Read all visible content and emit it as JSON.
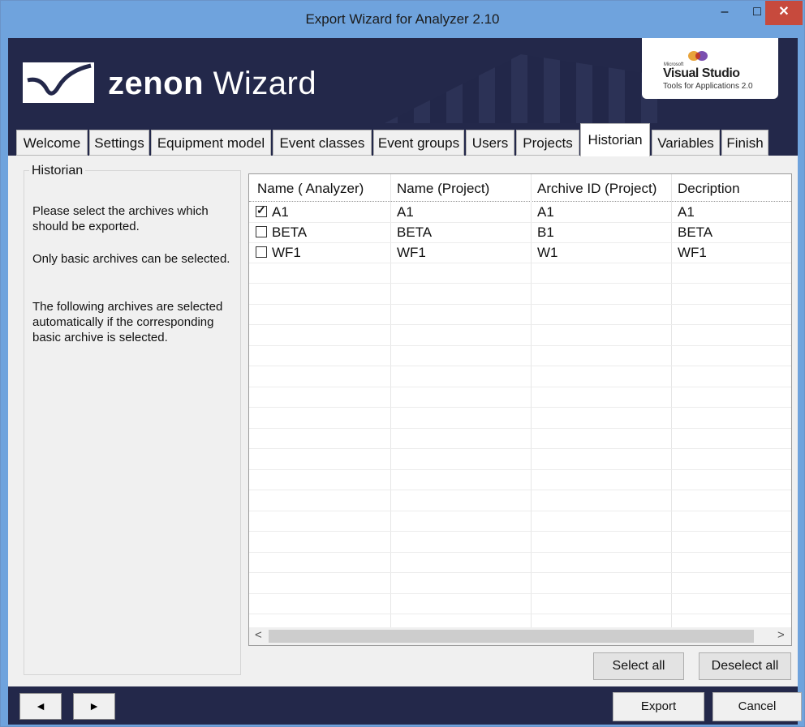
{
  "window": {
    "title": "Export Wizard for Analyzer 2.10",
    "minimize_glyph": "–",
    "maximize_glyph": "□",
    "close_glyph": "✕"
  },
  "banner": {
    "brand_bold": "zenon",
    "brand_rest": " Wizard",
    "vs_small": "Microsoft",
    "vs_name": "Visual Studio",
    "vs_sub": "Tools for Applications 2.0"
  },
  "tabs": [
    {
      "label": "Welcome"
    },
    {
      "label": "Settings"
    },
    {
      "label": "Equipment model"
    },
    {
      "label": "Event classes"
    },
    {
      "label": "Event groups"
    },
    {
      "label": "Users"
    },
    {
      "label": "Projects"
    },
    {
      "label": "Historian"
    },
    {
      "label": "Variables"
    },
    {
      "label": "Finish"
    }
  ],
  "active_tab": "Historian",
  "group": {
    "label": "Historian",
    "paragraphs": [
      "Please select the archives which should be exported.",
      "Only basic archives can be selected.",
      "The following archives are selected automatically if the corresponding basic archive is selected."
    ]
  },
  "grid": {
    "columns": [
      "Name ( Analyzer)",
      "Name (Project)",
      "Archive ID (Project)",
      "Decription"
    ],
    "rows": [
      {
        "checked": true,
        "cells": [
          "A1",
          "A1",
          "A1",
          "A1"
        ]
      },
      {
        "checked": false,
        "cells": [
          "BETA",
          "BETA",
          "B1",
          "BETA"
        ]
      },
      {
        "checked": false,
        "cells": [
          "WF1",
          "WF1",
          "W1",
          "WF1"
        ]
      }
    ],
    "scroll_left": "<",
    "scroll_right": ">"
  },
  "buttons": {
    "select_all": "Select all",
    "deselect_all": "Deselect all",
    "back": "◄",
    "forward": "►",
    "export": "Export",
    "cancel": "Cancel"
  },
  "colors": {
    "titlebar": "#6fa3dd",
    "banner": "#23284a",
    "close": "#c74a3d"
  }
}
